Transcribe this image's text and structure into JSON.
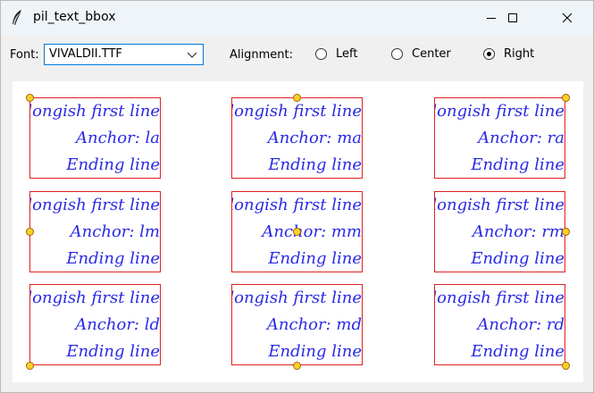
{
  "window": {
    "title": "pil_text_bbox",
    "icon": "feather-icon"
  },
  "toolbar": {
    "font_label": "Font:",
    "font_value": "VIVALDII.TTF",
    "alignment_label": "Alignment:",
    "alignment_options": [
      {
        "label": "Left",
        "selected": false
      },
      {
        "label": "Center",
        "selected": false
      },
      {
        "label": "Right",
        "selected": true
      }
    ]
  },
  "canvas": {
    "cells": [
      {
        "line1": "A longish first line",
        "line2": "Anchor: la",
        "line3": "Ending line"
      },
      {
        "line1": "A longish first line",
        "line2": "Anchor: ma",
        "line3": "Ending line"
      },
      {
        "line1": "A longish first line",
        "line2": "Anchor: ra",
        "line3": "Ending line"
      },
      {
        "line1": "A longish first line",
        "line2": "Anchor: lm",
        "line3": "Ending line"
      },
      {
        "line1": "A longish first line",
        "line2": "Anchor: mm",
        "line3": "Ending line"
      },
      {
        "line1": "A longish first line",
        "line2": "Anchor: rm",
        "line3": "Ending line"
      },
      {
        "line1": "A longish first line",
        "line2": "Anchor: ld",
        "line3": "Ending line"
      },
      {
        "line1": "A longish first line",
        "line2": "Anchor: md",
        "line3": "Ending line"
      },
      {
        "line1": "A longish first line",
        "line2": "Anchor: rd",
        "line3": "Ending line"
      }
    ],
    "colors": {
      "text": "#2a2ae6",
      "box": "#e02020",
      "anchor": "#f7d22a"
    }
  }
}
